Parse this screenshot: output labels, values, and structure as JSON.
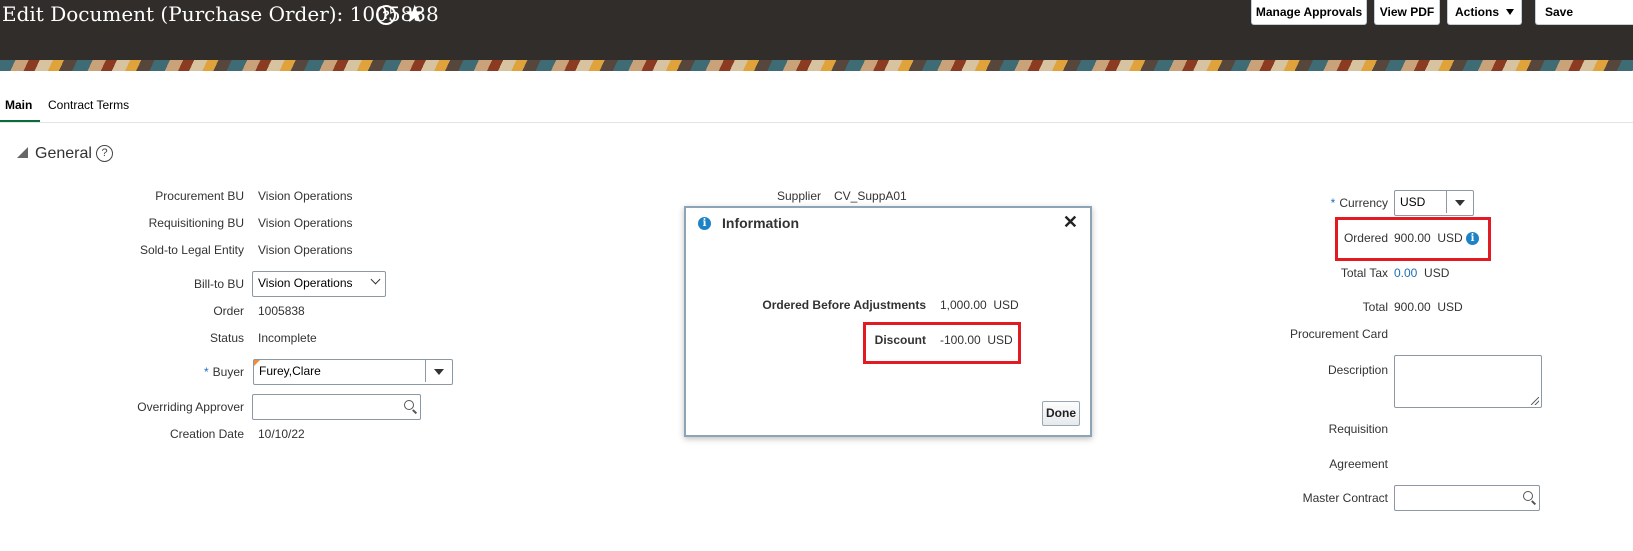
{
  "header": {
    "title": "Edit Document (Purchase Order): 1005838",
    "help_icon": "?",
    "star_icon": "★",
    "buttons": {
      "manage_approvals": "Manage Approvals",
      "view_pdf": "View PDF",
      "actions": "Actions",
      "save": "Save"
    }
  },
  "tabs": [
    {
      "label": "Main"
    },
    {
      "label": "Contract Terms"
    }
  ],
  "section": {
    "title": "General",
    "help": "?"
  },
  "left": {
    "procurement_bu_label": "Procurement BU",
    "procurement_bu": "Vision Operations",
    "requisitioning_bu_label": "Requisitioning BU",
    "requisitioning_bu": "Vision Operations",
    "sold_to_label": "Sold-to Legal Entity",
    "sold_to": "Vision Operations",
    "bill_to_label": "Bill-to BU",
    "bill_to": "Vision Operations",
    "order_label": "Order",
    "order": "1005838",
    "status_label": "Status",
    "status": "Incomplete",
    "buyer_required": "*",
    "buyer_label": "Buyer",
    "buyer": "Furey,Clare",
    "overriding_approver_label": "Overriding Approver",
    "overriding_approver": "",
    "creation_date_label": "Creation Date",
    "creation_date": "10/10/22"
  },
  "middle": {
    "supplier_label": "Supplier",
    "supplier": "CV_SuppA01"
  },
  "right": {
    "currency_required": "*",
    "currency_label": "Currency",
    "currency": "USD",
    "ordered_label": "Ordered",
    "ordered_amount": "900.00",
    "ordered_currency": "USD",
    "total_tax_label": "Total Tax",
    "total_tax_amount": "0.00",
    "total_tax_currency": "USD",
    "total_label": "Total",
    "total_amount": "900.00",
    "total_currency": "USD",
    "procurement_card_label": "Procurement Card",
    "description_label": "Description",
    "requisition_label": "Requisition",
    "agreement_label": "Agreement",
    "master_contract_label": "Master Contract"
  },
  "dialog": {
    "title": "Information",
    "close": "✕",
    "ordered_before_label": "Ordered Before Adjustments",
    "ordered_before_amount": "1,000.00",
    "ordered_before_currency": "USD",
    "discount_label": "Discount",
    "discount_amount": "-100.00",
    "discount_currency": "USD",
    "done_label": "Done"
  },
  "colors": {
    "header_bg": "#312d2a",
    "highlight": "#e21b23",
    "info_blue": "#1d83c6",
    "tab_active": "#0b6c3a"
  }
}
